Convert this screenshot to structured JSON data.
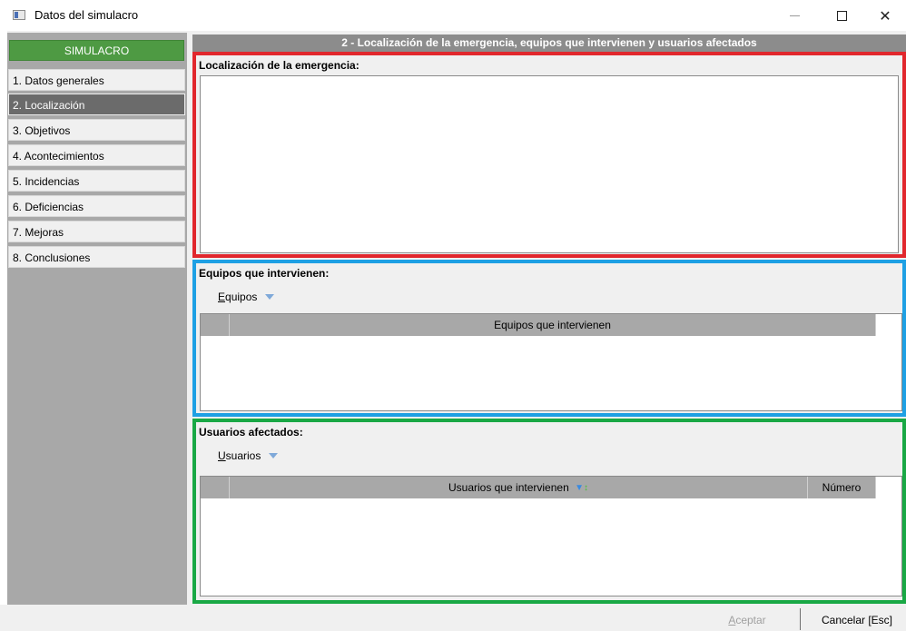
{
  "window": {
    "title": "Datos del simulacro",
    "close_glyph": "✕"
  },
  "sidebar": {
    "header": "SIMULACRO",
    "items": [
      {
        "label": "1. Datos generales"
      },
      {
        "label": "2. Localización"
      },
      {
        "label": "3. Objetivos"
      },
      {
        "label": "4. Acontecimientos"
      },
      {
        "label": "5. Incidencias"
      },
      {
        "label": "6. Deficiencias"
      },
      {
        "label": "7. Mejoras"
      },
      {
        "label": "8. Conclusiones"
      }
    ],
    "active_index": 1
  },
  "main": {
    "header": "2 - Localización de la emergencia, equipos que intervienen y usuarios afectados",
    "location": {
      "title": "Localización de la emergencia:",
      "value": ""
    },
    "equipment": {
      "title": "Equipos que intervienen:",
      "dropdown_mnemonic": "E",
      "dropdown_rest": "quipos",
      "columns": [
        "Equipos que intervienen"
      ]
    },
    "users": {
      "title": "Usuarios afectados:",
      "dropdown_mnemonic": "U",
      "dropdown_rest": "suarios",
      "columns": [
        "Usuarios que intervienen",
        "Número"
      ]
    }
  },
  "buttons": {
    "accept_mnemonic": "A",
    "accept_rest": "ceptar",
    "cancel": "Cancelar [Esc]"
  },
  "colors": {
    "accent_green": "#4e9a43",
    "section_red": "#e1272d",
    "section_blue": "#1ea0e4",
    "section_green": "#19a845"
  },
  "icons": [
    "app-window-icon",
    "minimize-icon",
    "maximize-icon",
    "close-icon",
    "caret-down-icon",
    "sort-icon"
  ]
}
